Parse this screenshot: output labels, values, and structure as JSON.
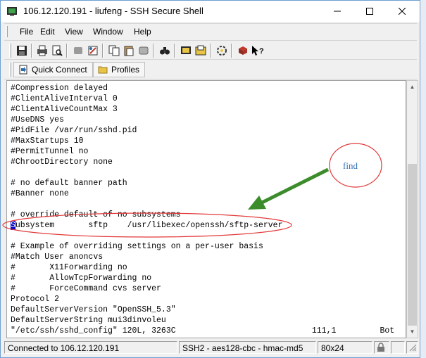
{
  "window": {
    "title": "106.12.120.191 - liufeng - SSH Secure Shell"
  },
  "menu": [
    {
      "label": "File"
    },
    {
      "label": "Edit"
    },
    {
      "label": "View"
    },
    {
      "label": "Window"
    },
    {
      "label": "Help"
    }
  ],
  "toolbar": {
    "icons": [
      "save-icon",
      "print-icon",
      "print-preview-icon",
      "disconnect-icon",
      "settings-icon",
      "copy-icon",
      "paste-icon",
      "paste-special-icon",
      "find-icon",
      "new-terminal-icon",
      "new-file-transfer-icon",
      "profile-settings-icon",
      "help-book-icon",
      "context-help-icon"
    ]
  },
  "quickbar": {
    "quick_connect": "Quick Connect",
    "profiles": "Profiles"
  },
  "terminal": {
    "lines": [
      "#Compression delayed",
      "#ClientAliveInterval 0",
      "#ClientAliveCountMax 3",
      "#UseDNS yes",
      "#PidFile /var/run/sshd.pid",
      "#MaxStartups 10",
      "#PermitTunnel no",
      "#ChrootDirectory none",
      "",
      "# no default banner path",
      "#Banner none",
      "",
      "# override default of no subsystems",
      "Subsystem       sftp    /usr/libexec/openssh/sftp-server",
      "",
      "# Example of overriding settings on a per-user basis",
      "#Match User anoncvs",
      "#       X11Forwarding no",
      "#       AllowTcpForwarding no",
      "#       ForceCommand cvs server",
      "Protocol 2",
      "DefaultServerVersion \"OpenSSH_5.3\"",
      "DefaultServerString mui3dinvoleu",
      "\"/etc/ssh/sshd_config\" 120L, 3263C                            111,1         Bot"
    ]
  },
  "status": {
    "connection": "Connected to 106.12.120.191",
    "cipher": "SSH2 - aes128-cbc - hmac-md5",
    "size": "80x24"
  },
  "annotation": {
    "callout": "find",
    "color": "#e23a3a",
    "arrow_color": "#3c8c2c"
  }
}
